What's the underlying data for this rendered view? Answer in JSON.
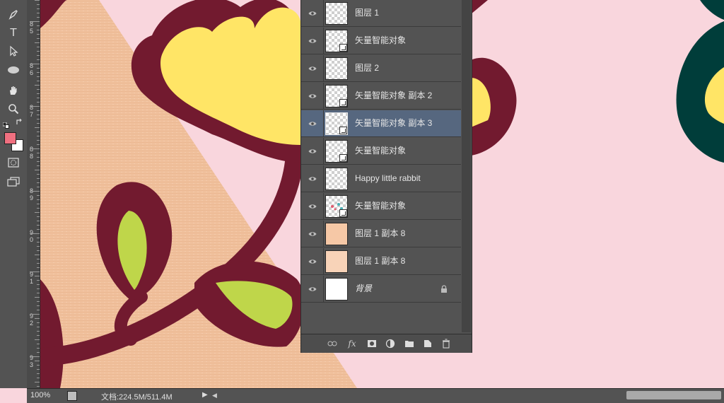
{
  "colors": {
    "canvas_bg": "#f9d6dd",
    "foreground_swatch": "#f07080",
    "background_swatch": "#ffffff",
    "vine": "#721a2f",
    "flower": "#ffe566",
    "leaf": "#bfd64a",
    "texture": "#f0c0a0",
    "dark_green": "#003d3a",
    "selected_row": "#56677f"
  },
  "toolbar": {
    "tools": [
      "pen-tool-icon",
      "type-tool-icon",
      "path-selection-icon",
      "ellipse-tool-icon",
      "hand-tool-icon",
      "zoom-tool-icon",
      "default-colors-icon",
      "swap-colors-icon",
      "quick-mask-icon",
      "screen-mode-icon"
    ],
    "type_glyph": "T"
  },
  "ruler": {
    "labels": [
      {
        "a": "8",
        "b": "5"
      },
      {
        "a": "8",
        "b": "6"
      },
      {
        "a": "8",
        "b": "7"
      },
      {
        "a": "8",
        "b": "8"
      },
      {
        "a": "8",
        "b": "9"
      },
      {
        "a": "9",
        "b": "0"
      },
      {
        "a": "9",
        "b": "1"
      },
      {
        "a": "9",
        "b": "2"
      },
      {
        "a": "9",
        "b": "3"
      }
    ]
  },
  "layers": {
    "rows": [
      {
        "name": "图层 1",
        "thumb": "checker",
        "smart": false,
        "selected": false
      },
      {
        "name": "矢量智能对象",
        "thumb": "checker",
        "smart": true,
        "selected": false
      },
      {
        "name": "图层 2",
        "thumb": "checker",
        "smart": false,
        "selected": false
      },
      {
        "name": "矢量智能对象 副本 2",
        "thumb": "checker",
        "smart": true,
        "selected": false
      },
      {
        "name": "矢量智能对象 副本 3",
        "thumb": "checker",
        "smart": true,
        "selected": true
      },
      {
        "name": "矢量智能对象",
        "thumb": "checker",
        "smart": true,
        "selected": false
      },
      {
        "name": "Happy little rabbit",
        "thumb": "checker",
        "smart": false,
        "selected": false
      },
      {
        "name": "矢量智能对象",
        "thumb": "checker-art",
        "smart": true,
        "selected": false
      },
      {
        "name": "图层 1 副本 8",
        "thumb": "peach",
        "smart": false,
        "selected": false
      },
      {
        "name": "图层 1 副本 8",
        "thumb": "peach2",
        "smart": false,
        "selected": false
      },
      {
        "name": "背景",
        "thumb": "white",
        "smart": false,
        "selected": false,
        "locked": true
      }
    ],
    "footer_buttons": [
      "link-layers-icon",
      "fx-icon",
      "add-mask-icon",
      "adjustment-layer-icon",
      "new-group-icon",
      "new-layer-icon",
      "delete-layer-icon"
    ],
    "fx_label": "fx"
  },
  "status": {
    "zoom": "100%",
    "doc_info": "文档:224.5M/511.4M"
  }
}
